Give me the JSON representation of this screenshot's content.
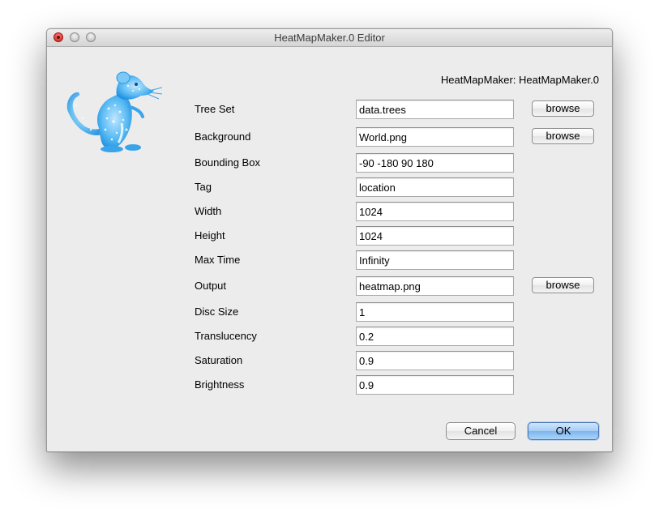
{
  "window": {
    "title": "HeatMapMaker.0 Editor"
  },
  "header": {
    "label": "HeatMapMaker: HeatMapMaker.0"
  },
  "logo": {
    "icon": "beast-mouse-logo-icon",
    "color": "#4fb3f0"
  },
  "fields": [
    {
      "label": "Tree Set",
      "value": "data.trees",
      "browse": "browse"
    },
    {
      "label": "Background",
      "value": "World.png",
      "browse": "browse"
    },
    {
      "label": "Bounding Box",
      "value": "-90 -180 90 180"
    },
    {
      "label": "Tag",
      "value": "location"
    },
    {
      "label": "Width",
      "value": "1024"
    },
    {
      "label": "Height",
      "value": "1024"
    },
    {
      "label": "Max Time",
      "value": "Infinity"
    },
    {
      "label": "Output",
      "value": "heatmap.png",
      "browse": "browse"
    },
    {
      "label": "Disc Size",
      "value": "1"
    },
    {
      "label": "Translucency",
      "value": "0.2"
    },
    {
      "label": "Saturation",
      "value": "0.9"
    },
    {
      "label": "Brightness",
      "value": "0.9"
    }
  ],
  "buttons": {
    "cancel": "Cancel",
    "ok": "OK"
  }
}
